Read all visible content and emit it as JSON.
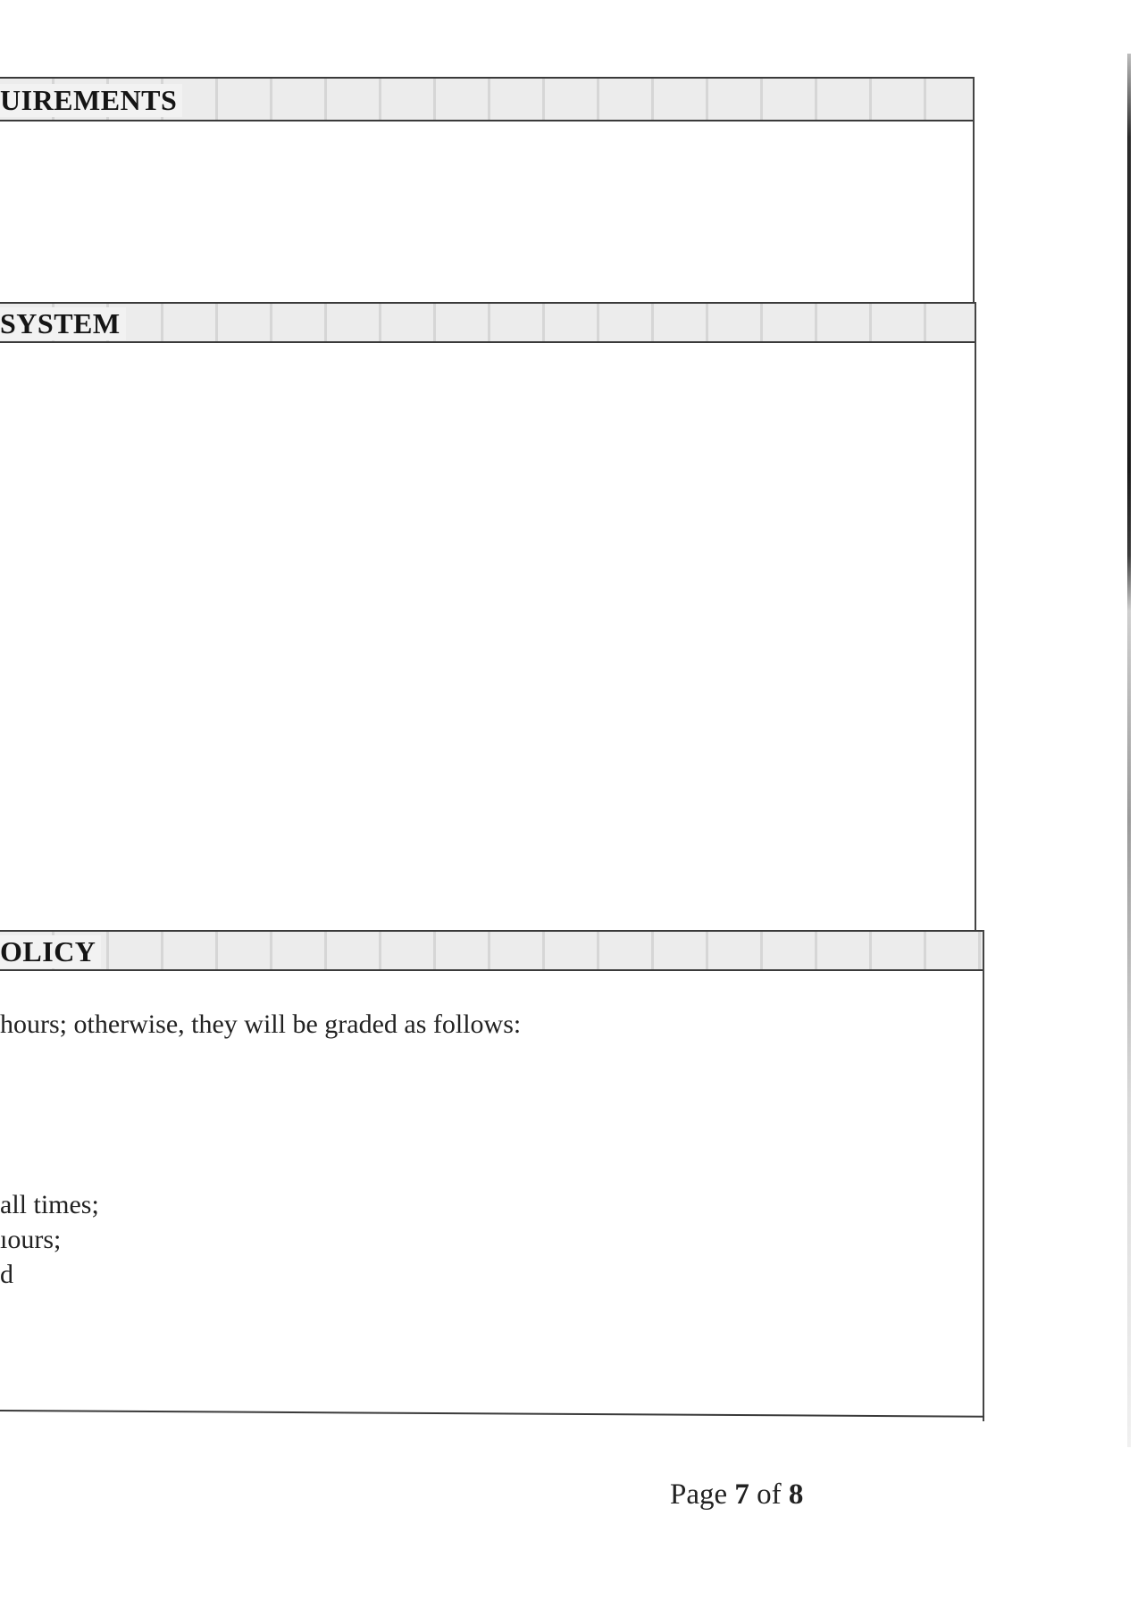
{
  "sections": [
    {
      "heading": "UIREMENTS",
      "lines": []
    },
    {
      "heading": "SYSTEM",
      "lines": []
    },
    {
      "heading": "OLICY",
      "lines": [
        "hours; otherwise, they will be graded as follows:",
        "all times;",
        "ıours;",
        "d"
      ]
    }
  ],
  "footer": {
    "page_label": "Page",
    "page_number": "7",
    "of_label": "of",
    "page_total": "8"
  }
}
